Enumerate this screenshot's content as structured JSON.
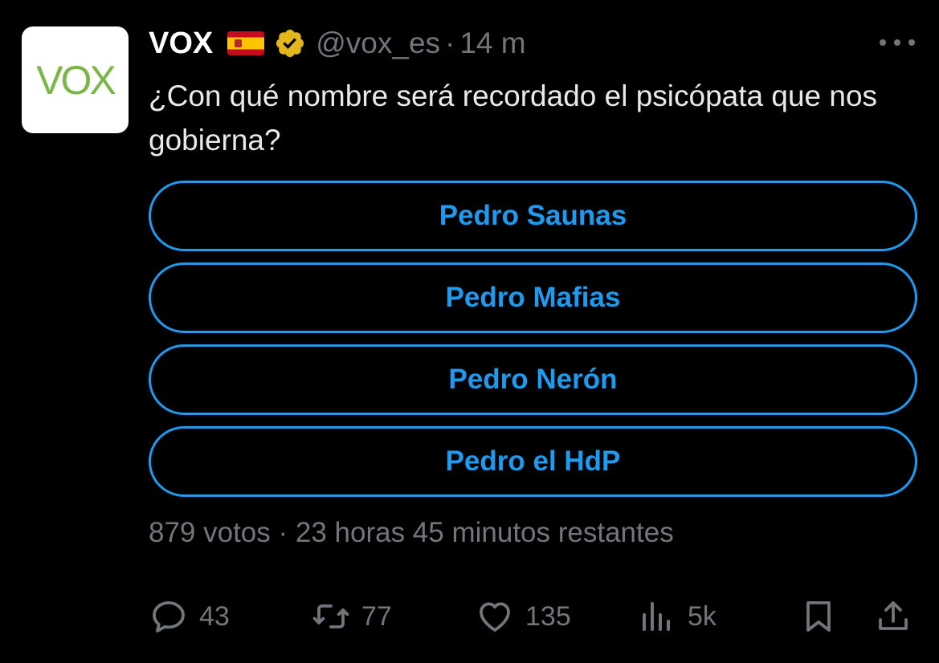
{
  "tweet": {
    "avatar_text": "VOX",
    "display_name": "VOX",
    "flag_icon": "spain-flag-icon",
    "verified_icon": "gold-verified-badge-icon",
    "handle": "@vox_es",
    "separator": "·",
    "time": "14 m",
    "text": "¿Con qué nombre será recordado el psicópata que nos gobierna?"
  },
  "poll": {
    "options": [
      "Pedro Saunas",
      "Pedro Mafias",
      "Pedro Nerón",
      "Pedro el HdP"
    ],
    "meta": "879 votos · 23 horas 45 minutos restantes"
  },
  "actions": {
    "replies": "43",
    "reposts": "77",
    "likes": "135",
    "views": "5k"
  },
  "colors": {
    "background": "#000000",
    "text": "#e7e9ea",
    "muted": "#71767b",
    "accent": "#1d9bf0",
    "avatar_green": "#7ab648",
    "verified_gold": "#e2b719"
  }
}
